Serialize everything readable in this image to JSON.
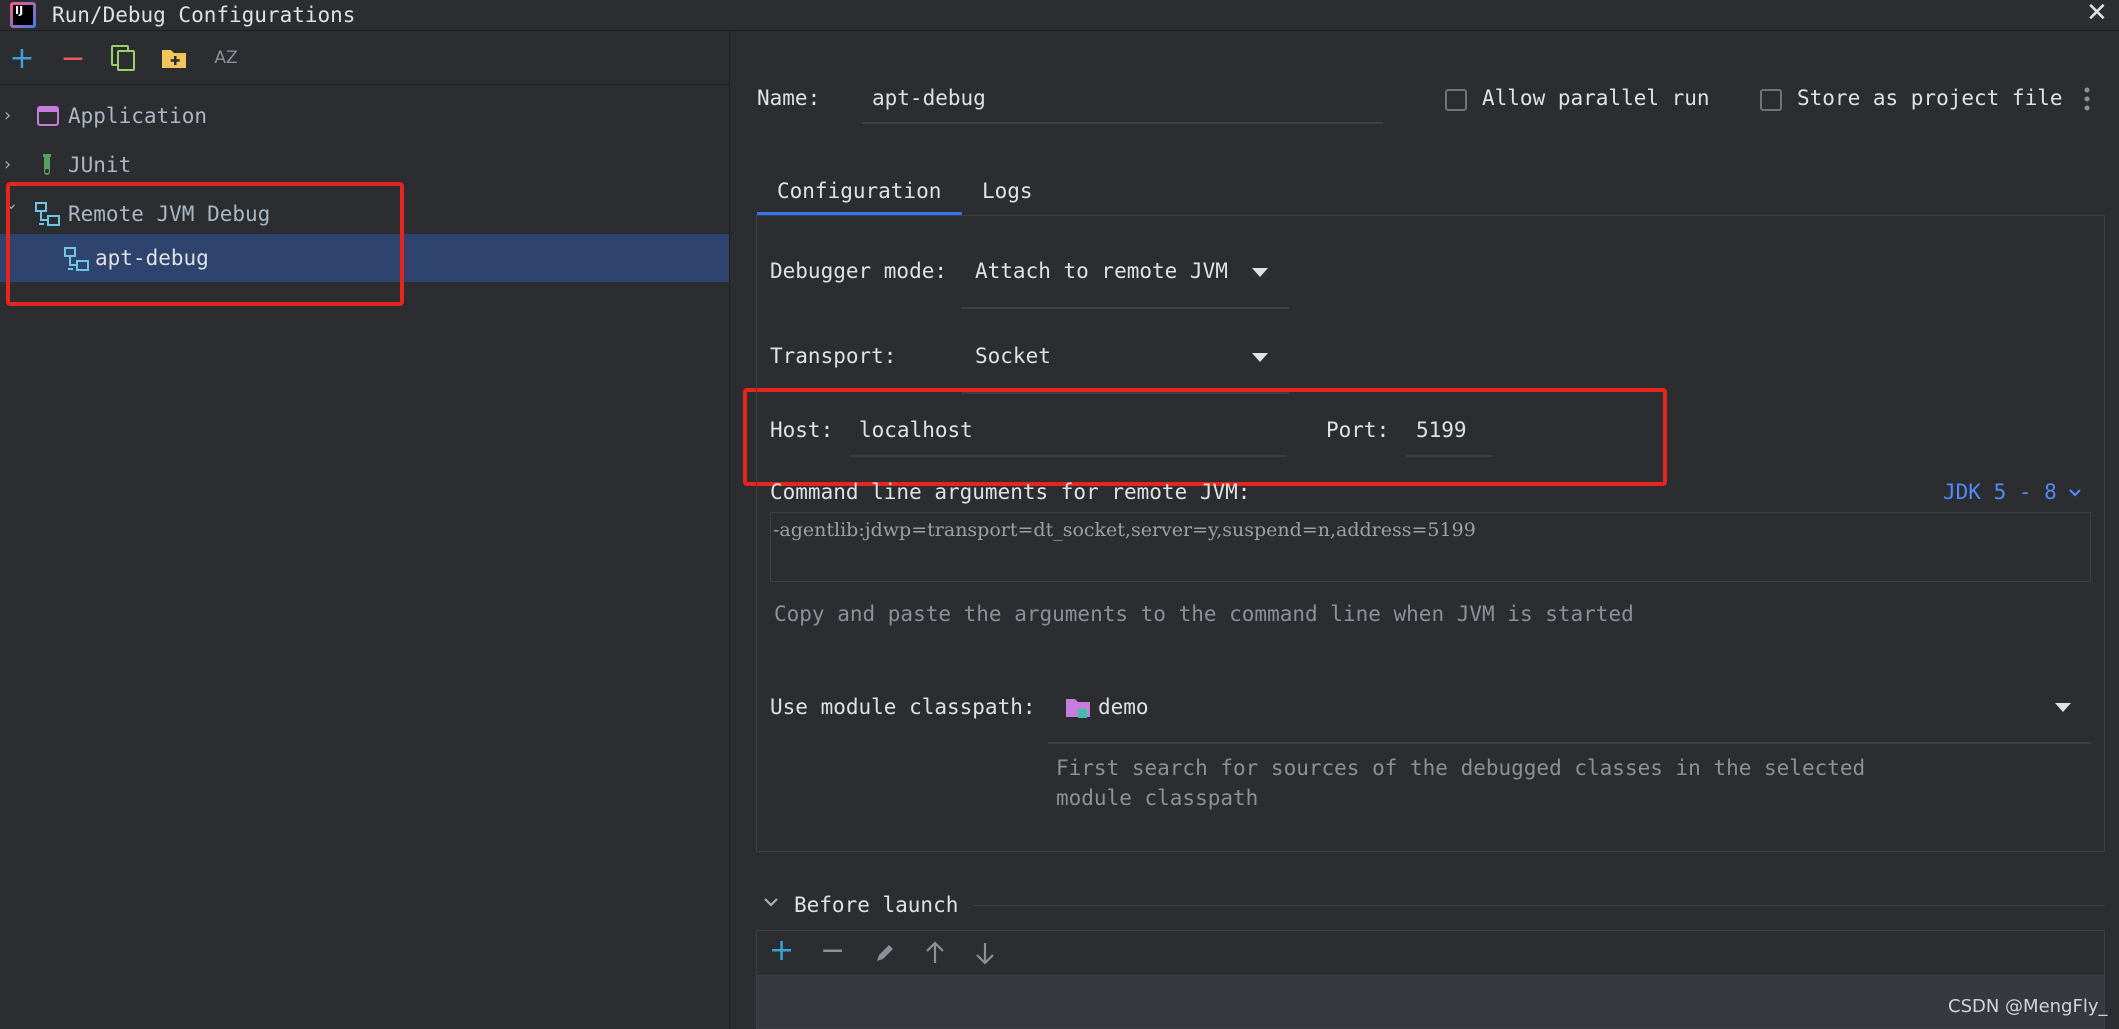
{
  "window": {
    "title": "Run/Debug Configurations",
    "logo_text": "IJ",
    "close_glyph": "✕"
  },
  "toolbar": {
    "add": "+",
    "remove": "−",
    "sort_label": "AZ",
    "icons": [
      "plus-icon",
      "minus-icon",
      "copy-icon",
      "new-folder-icon",
      "sort-alphabetically-icon"
    ]
  },
  "tree": {
    "items": [
      {
        "label": "Application",
        "expanded": false,
        "icon": "application-icon"
      },
      {
        "label": "JUnit",
        "expanded": false,
        "icon": "junit-icon"
      },
      {
        "label": "Remote JVM Debug",
        "expanded": true,
        "icon": "remote-debug-icon"
      },
      {
        "label": "apt-debug",
        "selected": true,
        "icon": "remote-debug-icon"
      }
    ]
  },
  "name_row": {
    "label": "Name:",
    "value": "apt-debug",
    "allow_parallel": "Allow parallel run",
    "store_as_file": "Store as project file"
  },
  "tabs": {
    "configuration": "Configuration",
    "logs": "Logs",
    "active": "Configuration"
  },
  "config": {
    "debugger_mode_label": "Debugger mode:",
    "debugger_mode_value": "Attach to remote JVM",
    "transport_label": "Transport:",
    "transport_value": "Socket",
    "host_label": "Host:",
    "host_value": "localhost",
    "port_label": "Port:",
    "port_value": "5199",
    "cmd_label": "Command line arguments for remote JVM:",
    "jdk_link": "JDK 5 - 8",
    "cmd_value": "-agentlib:jdwp=transport=dt_socket,server=y,suspend=n,address=5199",
    "cmd_hint": "Copy and paste the arguments to the command line when JVM is started",
    "module_label": "Use module classpath:",
    "module_value": "demo",
    "module_hint_1": "First search for sources of the debugged classes in the selected",
    "module_hint_2": "module classpath"
  },
  "before_launch": {
    "label": "Before launch"
  },
  "watermark": "CSDN @MengFly_",
  "colors": {
    "background": "#2b2d30",
    "selection": "#2e436e",
    "accent": "#3574f0",
    "annotation_red": "#e5261e",
    "link": "#548af7"
  }
}
